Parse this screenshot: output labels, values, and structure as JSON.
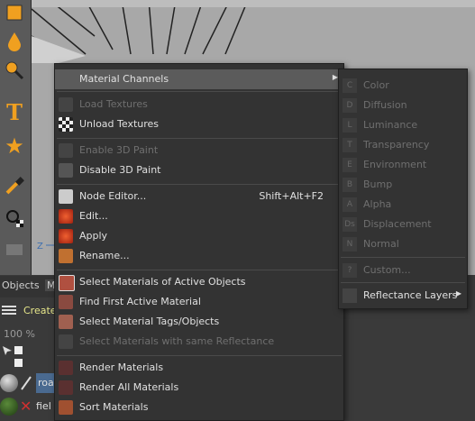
{
  "left_tabs": {
    "objects": "Objects",
    "materials": "M"
  },
  "toolbar2": {
    "create": "Create"
  },
  "zoom": "100 %",
  "axis_label": "Z",
  "materials": [
    {
      "name": "roa"
    },
    {
      "name": "fiel"
    }
  ],
  "context_menu": {
    "items": {
      "material_channels": "Material Channels",
      "load_textures": "Load Textures",
      "unload_textures": "Unload Textures",
      "enable_3d_paint": "Enable 3D Paint",
      "disable_3d_paint": "Disable 3D Paint",
      "node_editor": "Node Editor...",
      "node_editor_shortcut": "Shift+Alt+F2",
      "edit": "Edit...",
      "apply": "Apply",
      "rename": "Rename...",
      "select_active": "Select Materials of Active Objects",
      "find_first": "Find First Active Material",
      "select_tags": "Select Material Tags/Objects",
      "select_reflectance": "Select Materials with same Reflectance",
      "render_materials": "Render Materials",
      "render_all": "Render All Materials",
      "sort_materials": "Sort Materials"
    }
  },
  "submenu": {
    "color": "Color",
    "diffusion": "Diffusion",
    "luminance": "Luminance",
    "transparency": "Transparency",
    "environment": "Environment",
    "bump": "Bump",
    "alpha": "Alpha",
    "displacement": "Displacement",
    "normal": "Normal",
    "custom": "Custom...",
    "reflectance_layers": "Reflectance Layers",
    "icon_letters": {
      "color": "C",
      "diffusion": "D",
      "luminance": "L",
      "transparency": "T",
      "environment": "E",
      "bump": "B",
      "alpha": "A",
      "displacement": "Ds",
      "normal": "N",
      "custom": "?"
    }
  },
  "colors": {
    "menu_bg": "#333333",
    "highlight": "#5b5b5b",
    "disabled": "#6f6f6f",
    "accent_yellow": "#f0a020"
  }
}
